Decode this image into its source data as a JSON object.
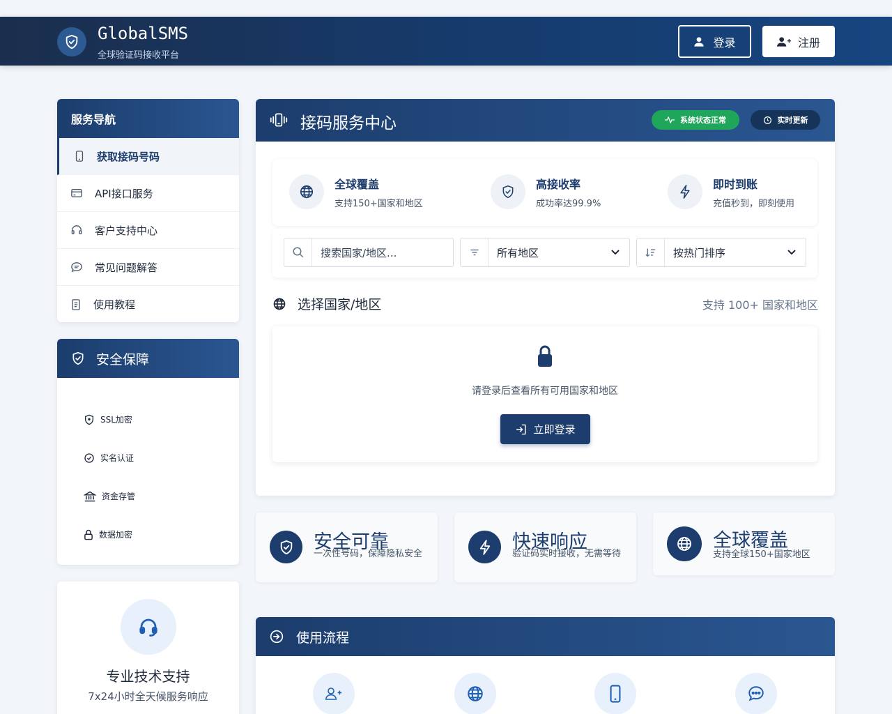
{
  "header": {
    "brand_title": "GlobalSMS",
    "brand_subtitle": "全球验证码接收平台",
    "login_label": "登录",
    "register_label": "注册"
  },
  "sidebar": {
    "nav_title": "服务导航",
    "items": [
      {
        "label": "获取接码号码",
        "icon": "phone-icon",
        "active": true
      },
      {
        "label": "API接口服务",
        "icon": "credit-card-icon",
        "active": false
      },
      {
        "label": "客户支持中心",
        "icon": "headset-icon",
        "active": false
      },
      {
        "label": "常见问题解答",
        "icon": "chat-icon",
        "active": false
      },
      {
        "label": "使用教程",
        "icon": "document-icon",
        "active": false
      }
    ],
    "security_title": "安全保障",
    "security_items": [
      {
        "label": "SSL加密",
        "icon": "shield-icon"
      },
      {
        "label": "实名认证",
        "icon": "check-circle-icon"
      },
      {
        "label": "资金存管",
        "icon": "bank-icon"
      },
      {
        "label": "数据加密",
        "icon": "lock-icon"
      }
    ],
    "support_title": "专业技术支持",
    "support_subtitle": "7x24小时全天候服务响应"
  },
  "main": {
    "title": "接码服务中心",
    "status_badge": "系统状态正常",
    "live_badge": "实时更新",
    "features": [
      {
        "title": "全球覆盖",
        "desc": "支持150+国家和地区",
        "icon": "globe-icon"
      },
      {
        "title": "高接收率",
        "desc": "成功率达99.9%",
        "icon": "shield-icon"
      },
      {
        "title": "即时到账",
        "desc": "充值秒到，即刻使用",
        "icon": "bolt-icon"
      }
    ],
    "search_placeholder": "搜索国家/地区...",
    "region_select": "所有地区",
    "sort_select": "按热门排序",
    "section_title": "选择国家/地区",
    "section_note": "支持 100+ 国家和地区",
    "locked_message": "请登录后查看所有可用国家和地区",
    "login_now_label": "立即登录"
  },
  "tiles": [
    {
      "title": "安全可靠",
      "desc": "一次性号码，保障隐私安全",
      "icon": "shield-icon"
    },
    {
      "title": "快速响应",
      "desc": "验证码实时接收，无需等待",
      "icon": "bolt-icon"
    },
    {
      "title": "全球覆盖",
      "desc": "支持全球150+国家地区",
      "icon": "globe-icon"
    }
  ],
  "process": {
    "title": "使用流程"
  },
  "colors": {
    "primary": "#1c3d6d",
    "header_bg": "#1b2e4d",
    "status_green": "#1fa65a",
    "page_bg": "#f2f5f9"
  }
}
